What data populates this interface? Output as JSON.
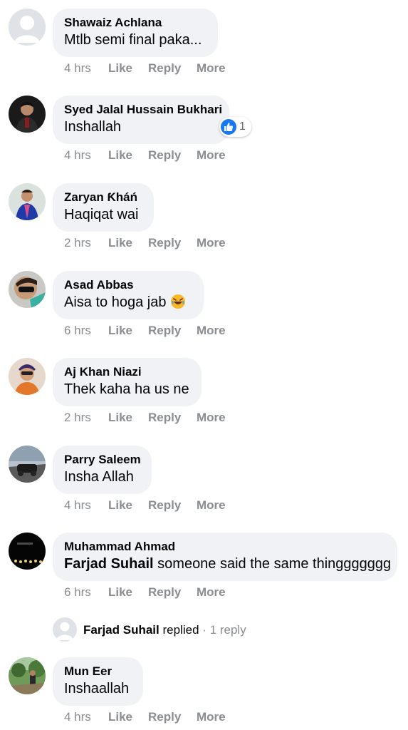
{
  "comments": [
    {
      "name": "Shawaiz Achlana",
      "text": "Mtlb semi final paka...",
      "time": "4 hrs",
      "like": "Like",
      "reply": "Reply",
      "more": "More"
    },
    {
      "name": "Syed Jalal Hussain Bukhari",
      "text": "Inshallah",
      "time": "4 hrs",
      "like": "Like",
      "reply": "Reply",
      "more": "More",
      "reaction_count": "1"
    },
    {
      "name": "Zaryan Ƙháń",
      "text": "Haqiqat wai",
      "time": "2 hrs",
      "like": "Like",
      "reply": "Reply",
      "more": "More"
    },
    {
      "name": "Asad Abbas",
      "text": "Aisa to hoga jab",
      "time": "6 hrs",
      "like": "Like",
      "reply": "Reply",
      "more": "More"
    },
    {
      "name": "Aj Khan Niazi",
      "text": "Thek kaha ha us ne",
      "time": "2 hrs",
      "like": "Like",
      "reply": "Reply",
      "more": "More"
    },
    {
      "name": "Parry Saleem",
      "text": "Insha Allah",
      "time": "4 hrs",
      "like": "Like",
      "reply": "Reply",
      "more": "More"
    },
    {
      "name": "Muhammad Ahmad",
      "mention": "Farjad Suhail",
      "text": "someone said the same thinggggggg",
      "time": "6 hrs",
      "like": "Like",
      "reply": "Reply",
      "more": "More"
    },
    {
      "name": "Mun Eer",
      "text": "Inshaallah",
      "time": "4 hrs",
      "like": "Like",
      "reply": "Reply",
      "more": "More"
    }
  ],
  "replies_summary": {
    "name": "Farjad Suhail",
    "verb": "replied",
    "separator": "·",
    "count": "1 reply"
  },
  "colors": {
    "bubble": "#f0f2f5",
    "meta": "#8a8d91",
    "like_blue": "#1877f2"
  }
}
